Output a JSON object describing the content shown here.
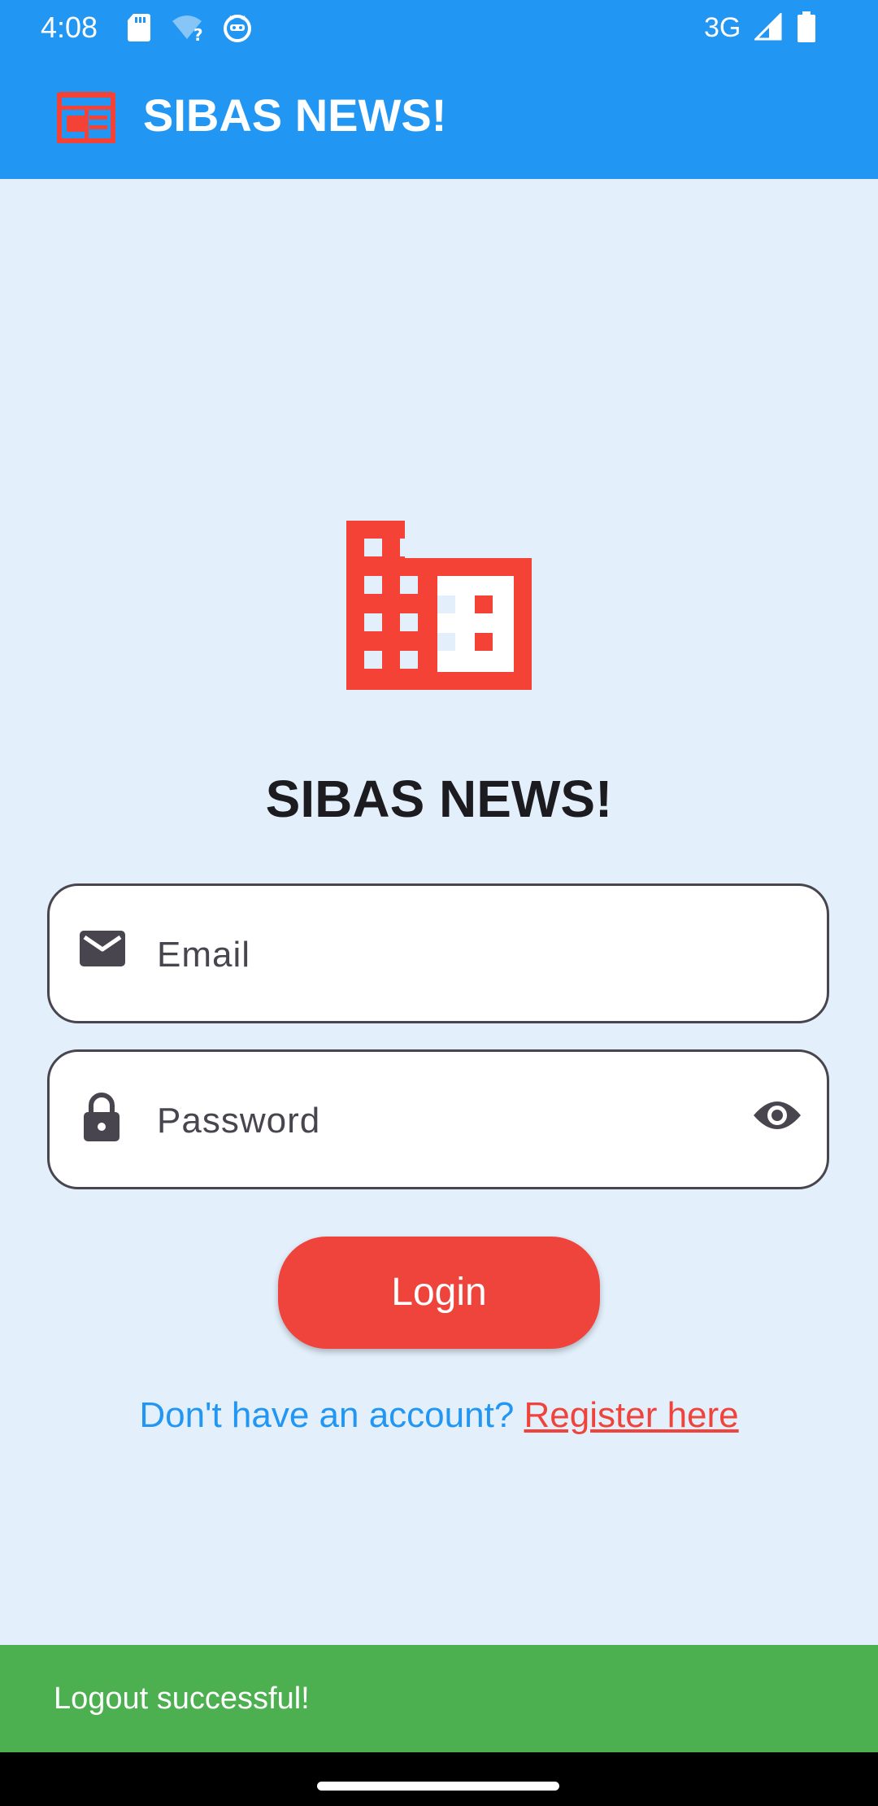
{
  "status_bar": {
    "time": "4:08",
    "network": "3G",
    "icons": [
      "sd-card-icon",
      "wifi-question-icon",
      "android-cat-icon",
      "signal-icon",
      "battery-icon"
    ]
  },
  "app_bar": {
    "title": "SIBAS NEWS!",
    "logo_icon": "newspaper-icon"
  },
  "login": {
    "hero_icon": "building-icon",
    "title": "SIBAS NEWS!",
    "email_placeholder": "Email",
    "email_icon": "mail-icon",
    "password_placeholder": "Password",
    "password_icon": "lock-icon",
    "visibility_icon": "eye-icon",
    "login_label": "Login",
    "register_prompt": "Don't have an account? ",
    "register_link": "Register here"
  },
  "snackbar": {
    "message": "Logout successful!"
  },
  "colors": {
    "primary": "#2196F3",
    "accent": "#EF443B",
    "background": "#E3F0FC",
    "success": "#4CAF50"
  }
}
